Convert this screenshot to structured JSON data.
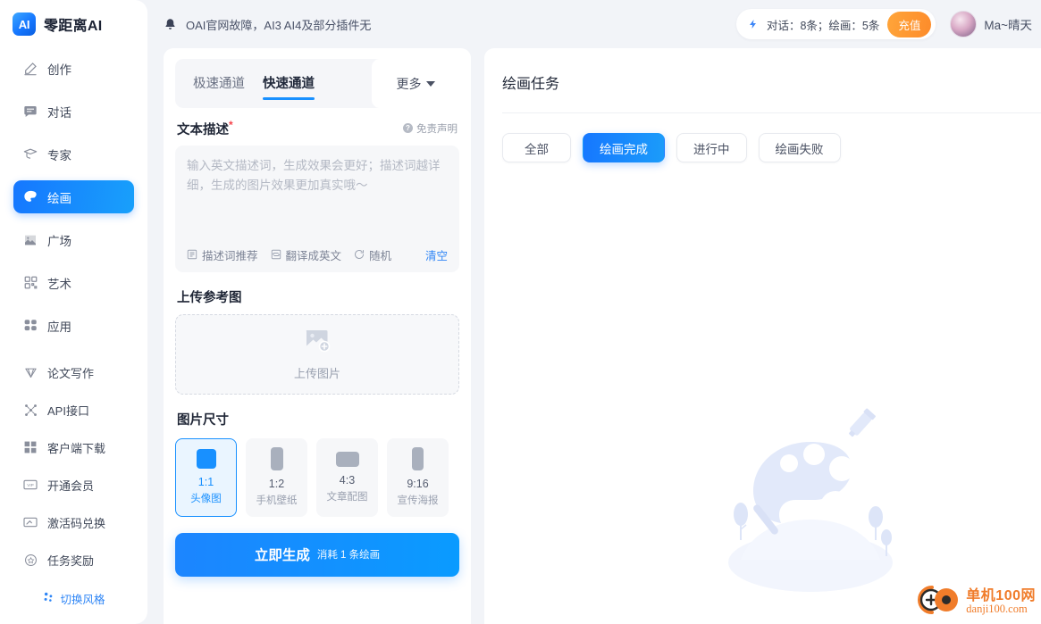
{
  "brand": {
    "logo_text": "AI",
    "name": "零距离AI"
  },
  "sidebar": {
    "items": [
      {
        "label": "创作",
        "icon": "pencil-icon"
      },
      {
        "label": "对话",
        "icon": "chat-bubble-icon"
      },
      {
        "label": "专家",
        "icon": "graduation-cap-icon"
      },
      {
        "label": "绘画",
        "icon": "palette-icon",
        "active": true
      },
      {
        "label": "广场",
        "icon": "image-icon"
      },
      {
        "label": "艺术",
        "icon": "grid-art-icon"
      },
      {
        "label": "应用",
        "icon": "apps-icon"
      }
    ],
    "items2": [
      {
        "label": "论文写作",
        "icon": "diamond-pen-icon"
      },
      {
        "label": "API接口",
        "icon": "api-node-icon"
      },
      {
        "label": "客户端下载",
        "icon": "squares-download-icon"
      },
      {
        "label": "开通会员",
        "icon": "vip-card-icon"
      },
      {
        "label": "激活码兑换",
        "icon": "ticket-icon"
      },
      {
        "label": "任务奖励",
        "icon": "reward-coin-icon"
      }
    ],
    "switch_style": "切换风格"
  },
  "topbar": {
    "notice": "OAI官网故障，AI3 AI4及部分插件无",
    "quota": "对话：8条；绘画：5条",
    "recharge_label": "充值",
    "username": "Ma~晴天"
  },
  "panel": {
    "tabs": [
      {
        "label": "极速通道",
        "active": false
      },
      {
        "label": "快速通道",
        "active": true
      }
    ],
    "more_label": "更多",
    "text_desc_title": "文本描述",
    "required_mark": "*",
    "disclaimer": "免责声明",
    "prompt_value": "",
    "prompt_placeholder": "输入英文描述词，生成效果会更好；描述词越详细，生成的图片效果更加真实哦～",
    "prompt_tools": [
      {
        "label": "描述词推荐",
        "icon": "list-suggest-icon"
      },
      {
        "label": "翻译成英文",
        "icon": "translate-icon"
      },
      {
        "label": "随机",
        "icon": "refresh-random-icon"
      }
    ],
    "clear_label": "清空",
    "upload_title": "上传参考图",
    "upload_label": "上传图片",
    "size_title": "图片尺寸",
    "sizes": [
      {
        "ratio": "1:1",
        "caption": "头像图",
        "active": true
      },
      {
        "ratio": "1:2",
        "caption": "手机壁纸",
        "active": false
      },
      {
        "ratio": "4:3",
        "caption": "文章配图",
        "active": false
      },
      {
        "ratio": "9:16",
        "caption": "宣传海报",
        "active": false
      }
    ],
    "generate_main": "立即生成",
    "generate_sub": "消耗 1 条绘画"
  },
  "tasks": {
    "title": "绘画任务",
    "filters": [
      {
        "label": "全部",
        "active": false
      },
      {
        "label": "绘画完成",
        "active": true
      },
      {
        "label": "进行中",
        "active": false
      },
      {
        "label": "绘画失败",
        "active": false
      }
    ]
  },
  "watermark": {
    "cn": "单机100网",
    "en": "danji100.com"
  },
  "colors": {
    "accent": "#1677ff",
    "accent_light": "#18a0fb",
    "orange": "#fd8b2a",
    "text_dark": "#1f2636",
    "text_muted": "#9aa1b0",
    "bg": "#f2f4f8",
    "watermark_orange": "#f07c2a"
  }
}
